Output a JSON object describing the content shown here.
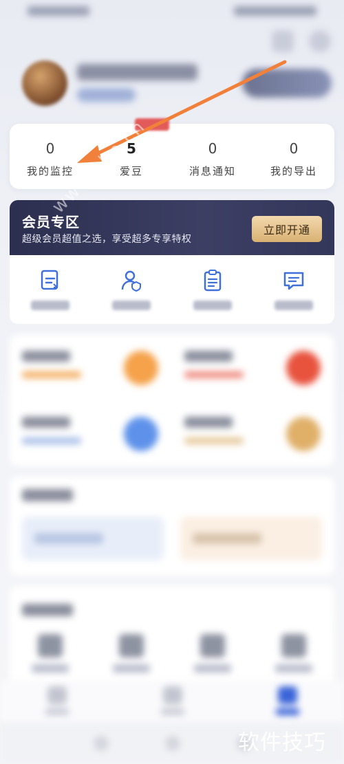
{
  "stats": [
    {
      "value": "0",
      "label": "我的监控"
    },
    {
      "value": "5",
      "label": "爱豆"
    },
    {
      "value": "0",
      "label": "消息通知"
    },
    {
      "value": "0",
      "label": "我的导出"
    }
  ],
  "member": {
    "title": "会员专区",
    "subtitle": "超级会员超值之选，享受超多专享特权",
    "button": "立即开通"
  },
  "watermarks": {
    "site": "www.php.cn",
    "corner": "软件技巧"
  },
  "colors": {
    "accent": "#3a64d8",
    "banner_bg": "#2c2f4f",
    "member_button": "#e3c08a",
    "annotation_arrow": "#f0803a"
  },
  "icons": {
    "actions": [
      "refresh-doc-icon",
      "user-badge-icon",
      "document-list-icon",
      "chat-bubble-icon"
    ]
  }
}
